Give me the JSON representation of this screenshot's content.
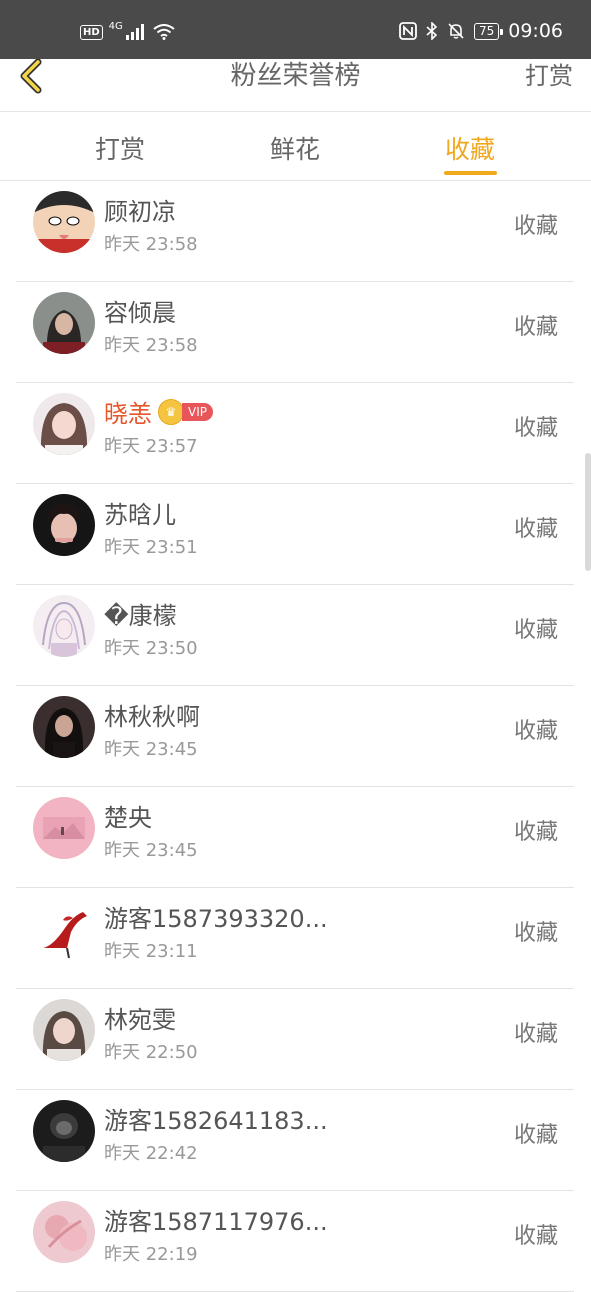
{
  "status_bar": {
    "hd": "HD",
    "network": "4G",
    "battery": "75",
    "time": "09:06"
  },
  "header": {
    "title": "粉丝荣誉榜",
    "right_action": "打赏"
  },
  "tabs": [
    {
      "label": "打赏"
    },
    {
      "label": "鲜花"
    },
    {
      "label": "收藏"
    }
  ],
  "active_tab": "收藏",
  "colors": {
    "accent": "#f0a81f",
    "vip_name": "#e6552b",
    "status_bar": "#4a4a4a"
  },
  "vip_badge": "VIP",
  "fans": [
    {
      "name": "顾初凉",
      "time": "昨天 23:58",
      "action": "收藏"
    },
    {
      "name": "容倾晨",
      "time": "昨天 23:58",
      "action": "收藏"
    },
    {
      "name": "晓恙",
      "time": "昨天 23:57",
      "action": "收藏"
    },
    {
      "name": "苏晗儿",
      "time": "昨天 23:51",
      "action": "收藏"
    },
    {
      "name": "�康檬",
      "time": "昨天 23:50",
      "action": "收藏"
    },
    {
      "name": "林秋秋啊",
      "time": "昨天 23:45",
      "action": "收藏"
    },
    {
      "name": "楚央",
      "time": "昨天 23:45",
      "action": "收藏"
    },
    {
      "name": "游客1587393320...",
      "time": "昨天 23:11",
      "action": "收藏"
    },
    {
      "name": "林宛雯",
      "time": "昨天 22:50",
      "action": "收藏"
    },
    {
      "name": "游客1582641183...",
      "time": "昨天 22:42",
      "action": "收藏"
    },
    {
      "name": "游客1587117976...",
      "time": "昨天 22:19",
      "action": "收藏"
    }
  ]
}
